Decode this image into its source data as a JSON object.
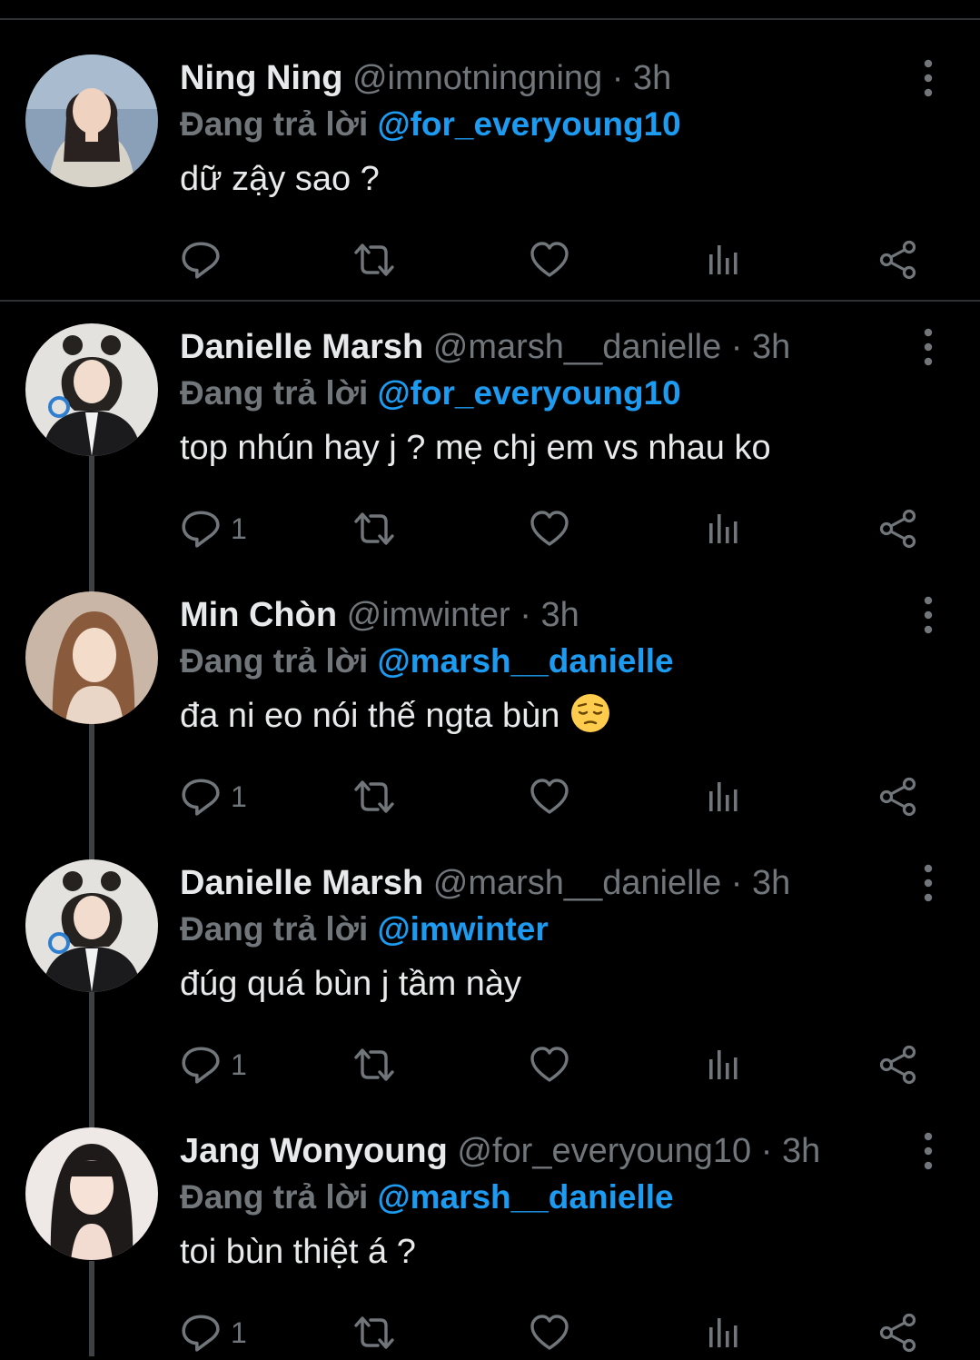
{
  "reply_prefix": "Đang trả lời",
  "colors": {
    "background": "#000000",
    "text": "#e7e9ea",
    "secondary": "#71767b",
    "mention": "#1d9bf0",
    "divider": "#2f3336"
  },
  "tweets": [
    {
      "name": "Ning Ning",
      "handle": "@imnotningning",
      "time": "· 3h",
      "replying_to": "@for_everyoung10",
      "text": "dữ zậy sao ?",
      "reply_count": "",
      "avatar_icon": "avatar-photo",
      "more_icon": "more-vertical-icon"
    },
    {
      "name": "Danielle Marsh",
      "handle": "@marsh__danielle",
      "time": "· 3h",
      "replying_to": "@for_everyoung10",
      "text": "top nhún hay j ? mẹ chj em vs nhau ko",
      "reply_count": "1",
      "avatar_icon": "avatar-photo",
      "more_icon": "more-vertical-icon"
    },
    {
      "name": "Min Chòn",
      "handle": "@imwinter",
      "time": "· 3h",
      "replying_to": "@marsh__danielle",
      "text": "đa ni eo nói thế ngta bùn",
      "emoji": "pensive-face-emoji",
      "reply_count": "1",
      "avatar_icon": "avatar-photo",
      "more_icon": "more-vertical-icon"
    },
    {
      "name": "Danielle Marsh",
      "handle": "@marsh__danielle",
      "time": "· 3h",
      "replying_to": "@imwinter",
      "text": "đúg quá bùn j tầm này",
      "reply_count": "1",
      "avatar_icon": "avatar-photo",
      "more_icon": "more-vertical-icon"
    },
    {
      "name": "Jang Wonyoung",
      "handle": "@for_everyoung10",
      "time": "· 3h",
      "replying_to": "@marsh__danielle",
      "text": "toi bùn thiệt á ?",
      "reply_count": "1",
      "avatar_icon": "avatar-photo",
      "more_icon": "more-vertical-icon"
    }
  ],
  "action_icons": [
    "reply-icon",
    "retweet-icon",
    "like-icon",
    "views-icon",
    "share-icon"
  ]
}
